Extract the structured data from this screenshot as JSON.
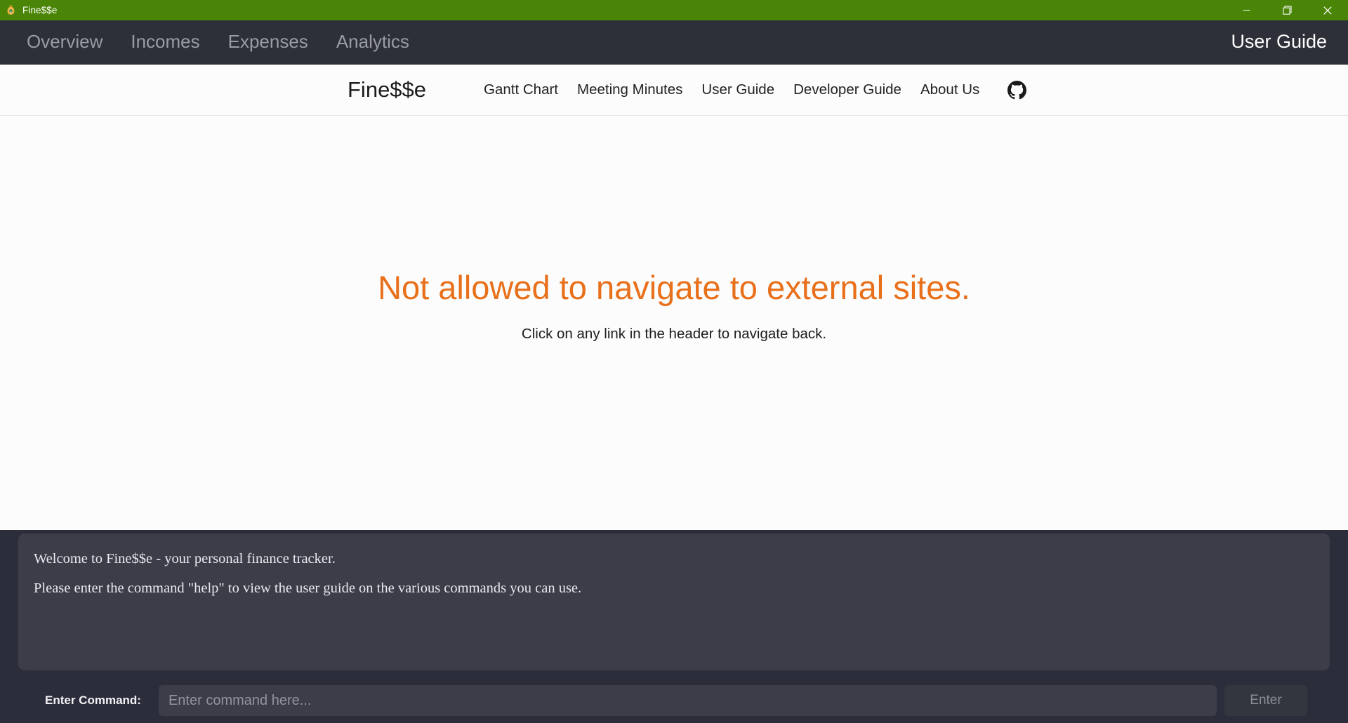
{
  "window": {
    "title": "Fine$$e",
    "icon": "money-bag-icon",
    "titlebar_color": "#4a8507",
    "controls": {
      "minimize": "minimize-icon",
      "maximize": "restore-icon",
      "close": "close-icon"
    }
  },
  "app_nav": {
    "tabs": [
      {
        "label": "Overview",
        "active": false
      },
      {
        "label": "Incomes",
        "active": false
      },
      {
        "label": "Expenses",
        "active": false
      },
      {
        "label": "Analytics",
        "active": false
      }
    ],
    "right_tab": {
      "label": "User Guide",
      "active": true
    },
    "background_color": "#2e3039",
    "inactive_color": "#9a9ca4",
    "active_color": "#ffffff"
  },
  "webview": {
    "brand": "Fine$$e",
    "links": [
      "Gantt Chart",
      "Meeting Minutes",
      "User Guide",
      "Developer Guide",
      "About Us"
    ],
    "github_icon": "github-icon",
    "error_title": "Not allowed to navigate to external sites.",
    "error_subtitle": "Click on any link in the header to navigate back.",
    "error_title_color": "#e8701a",
    "background_color": "#fcfcfc"
  },
  "console": {
    "lines": [
      "Welcome to Fine$$e - your personal finance tracker.",
      "Please enter the command \"help\" to view the user guide on the various commands you can use."
    ],
    "panel_color": "#3c3d49",
    "text_color": "#e9e9ef"
  },
  "command_bar": {
    "label": "Enter Command:",
    "input_value": "",
    "input_placeholder": "Enter command here...",
    "enter_label": "Enter"
  }
}
